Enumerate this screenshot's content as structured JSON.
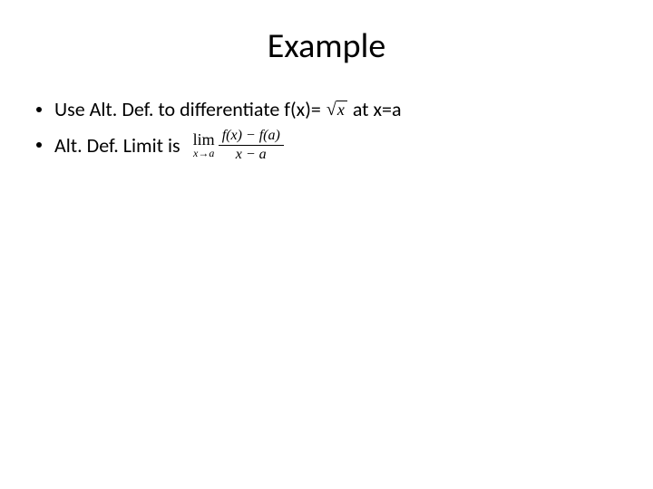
{
  "title": "Example",
  "bullets": {
    "b1_text_a": "Use Alt. Def. to differentiate f(x)=",
    "b1_radicand": "x",
    "b1_text_b": "at  x=a",
    "b2_text": "Alt. Def. Limit is",
    "lim_word": "lim",
    "lim_sub": "x→a",
    "frac_num": "f(x) − f(a)",
    "frac_den": "x − a"
  }
}
